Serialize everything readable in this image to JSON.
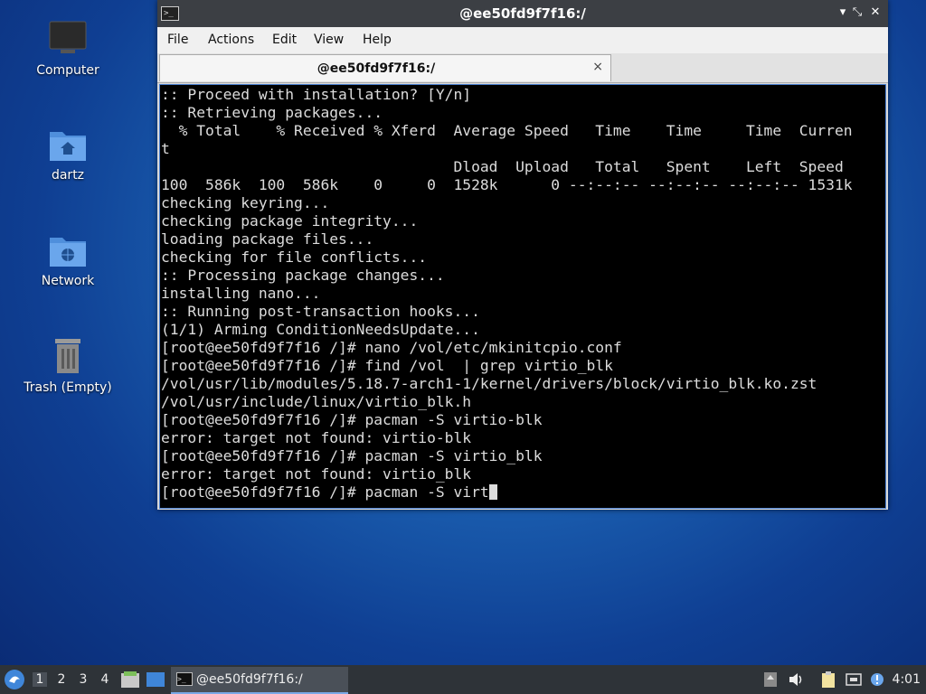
{
  "desktop": {
    "icons": [
      {
        "label": "Computer",
        "icon": "monitor-icon"
      },
      {
        "label": "dartz",
        "icon": "home-folder-icon"
      },
      {
        "label": "Network",
        "icon": "network-folder-icon"
      },
      {
        "label": "Trash (Empty)",
        "icon": "trash-icon"
      }
    ]
  },
  "window": {
    "title": "@ee50fd9f7f16:/",
    "controls": {
      "minimize": "▾",
      "maximize": "⤡",
      "close": "✕"
    },
    "menu": [
      "File",
      "Actions",
      "Edit",
      "View",
      "Help"
    ],
    "tab": {
      "label": "@ee50fd9f7f16:/",
      "close": "×"
    }
  },
  "terminal": {
    "lines": [
      ":: Proceed with installation? [Y/n]",
      ":: Retrieving packages...",
      "  % Total    % Received % Xferd  Average Speed   Time    Time     Time  Curren",
      "t",
      "                                 Dload  Upload   Total   Spent    Left  Speed",
      "100  586k  100  586k    0     0  1528k      0 --:--:-- --:--:-- --:--:-- 1531k",
      "checking keyring...",
      "checking package integrity...",
      "loading package files...",
      "checking for file conflicts...",
      ":: Processing package changes...",
      "installing nano...",
      ":: Running post-transaction hooks...",
      "(1/1) Arming ConditionNeedsUpdate...",
      "[root@ee50fd9f7f16 /]# nano /vol/etc/mkinitcpio.conf",
      "[root@ee50fd9f7f16 /]# find /vol  | grep virtio_blk",
      "/vol/usr/lib/modules/5.18.7-arch1-1/kernel/drivers/block/virtio_blk.ko.zst",
      "/vol/usr/include/linux/virtio_blk.h",
      "[root@ee50fd9f7f16 /]# pacman -S virtio-blk",
      "error: target not found: virtio-blk",
      "[root@ee50fd9f7f16 /]# pacman -S virtio_blk",
      "error: target not found: virtio_blk"
    ],
    "current_prompt": "[root@ee50fd9f7f16 /]# pacman -S virt"
  },
  "taskbar": {
    "workspaces": [
      "1",
      "2",
      "3",
      "4"
    ],
    "active_workspace": "1",
    "task": {
      "label": "@ee50fd9f7f16:/"
    },
    "clock": "4:01",
    "tray_icons": [
      "upload-icon",
      "volume-icon",
      "clipboard-icon",
      "network-icon",
      "notification-icon"
    ],
    "accent": "#7aa8e6"
  }
}
